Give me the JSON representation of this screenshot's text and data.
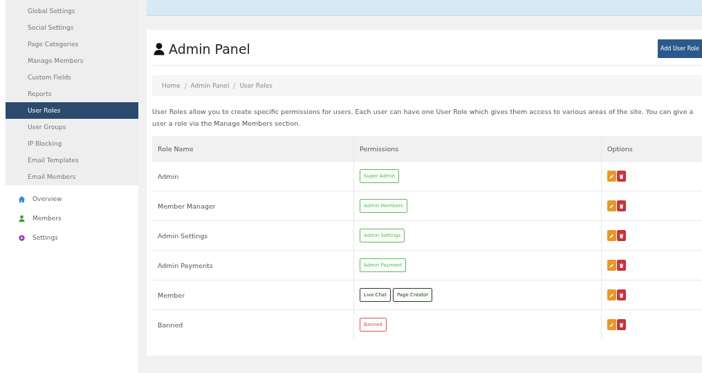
{
  "sidebar": {
    "subitems": [
      {
        "label": "Global Settings",
        "selected": false
      },
      {
        "label": "Social Settings",
        "selected": false
      },
      {
        "label": "Page Categories",
        "selected": false
      },
      {
        "label": "Manage Members",
        "selected": false
      },
      {
        "label": "Custom Fields",
        "selected": false
      },
      {
        "label": "Reports",
        "selected": false
      },
      {
        "label": "User Roles",
        "selected": true
      },
      {
        "label": "User Groups",
        "selected": false
      },
      {
        "label": "IP Blocking",
        "selected": false
      },
      {
        "label": "Email Templates",
        "selected": false
      },
      {
        "label": "Email Members",
        "selected": false
      }
    ],
    "sections": [
      {
        "label": "Overview",
        "kind": "home",
        "color": "#2a8bd6"
      },
      {
        "label": "Members",
        "kind": "user",
        "color": "#3a9a3a"
      },
      {
        "label": "Settings",
        "kind": "gear",
        "color": "#9b3fb0"
      }
    ]
  },
  "panel": {
    "title": "Admin Panel",
    "add_button": "Add User Role",
    "breadcrumb": [
      "Home",
      "Admin Panel",
      "User Roles"
    ],
    "description": "User Roles allow you to create specific permissions for users. Each user can have one User Role which gives them access to various areas of the site. You can give a user a role via the Manage Members section.",
    "table": {
      "columns": [
        "Role Name",
        "Permissions",
        "Options"
      ],
      "rows": [
        {
          "name": "Admin",
          "permissions": [
            {
              "label": "Super Admin",
              "color": "#5cb85c"
            }
          ]
        },
        {
          "name": "Member Manager",
          "permissions": [
            {
              "label": "Admin Members",
              "color": "#5cb85c"
            }
          ]
        },
        {
          "name": "Admin Settings",
          "permissions": [
            {
              "label": "Admin Settings",
              "color": "#5cb85c"
            }
          ]
        },
        {
          "name": "Admin Payments",
          "permissions": [
            {
              "label": "Admin Payment",
              "color": "#5cb85c"
            }
          ]
        },
        {
          "name": "Member",
          "permissions": [
            {
              "label": "Live Chat",
              "color": "#333333"
            },
            {
              "label": "Page Creator",
              "color": "#333333"
            }
          ]
        },
        {
          "name": "Banned",
          "permissions": [
            {
              "label": "Banned",
              "color": "#d9534f"
            }
          ]
        }
      ]
    }
  }
}
